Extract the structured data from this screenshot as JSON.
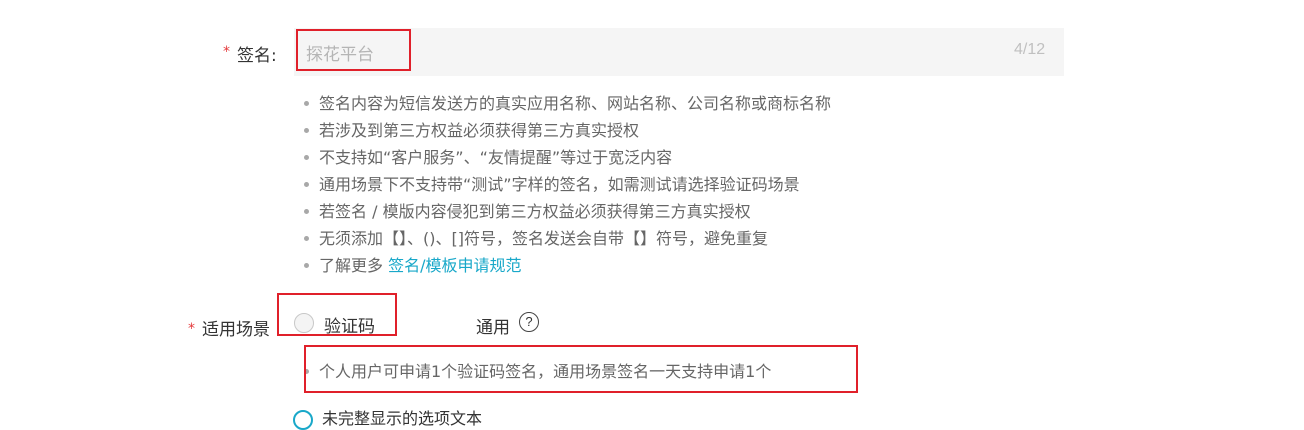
{
  "signature": {
    "required_mark": "*",
    "label": "签名:",
    "value": "探花平台",
    "counter": "4/12"
  },
  "tips": [
    {
      "text": "签名内容为短信发送方的真实应用名称、网站名称、公司名称或商标名称"
    },
    {
      "text": "若涉及到第三方权益必须获得第三方真实授权"
    },
    {
      "text": "不支持如“客户服务”、“友情提醒”等过于宽泛内容"
    },
    {
      "text": "通用场景下不支持带“测试”字样的签名，如需测试请选择验证码场景"
    },
    {
      "text": "若签名 / 模版内容侵犯到第三方权益必须获得第三方真实授权"
    },
    {
      "text": "无须添加【】、()、[]符号，签名发送会自带【】符号，避免重复"
    },
    {
      "text": "了解更多 ",
      "link": "签名/模板申请规范"
    }
  ],
  "scenario": {
    "required_mark": "*",
    "label": "适用场景",
    "options": [
      {
        "label": "验证码",
        "selected": false
      },
      {
        "label": "通用",
        "selected": false
      }
    ],
    "help_icon": "question-circle-icon",
    "help_glyph": "?",
    "note": "个人用户可申请1个验证码签名，通用场景签名一天支持申请1个"
  },
  "partial_row": {
    "text": "未完整显示的选项文本",
    "icon": "radio-circle-icon"
  },
  "colors": {
    "highlight_box": "#e0202a",
    "link": "#19a8c9",
    "required": "#e4393c"
  }
}
